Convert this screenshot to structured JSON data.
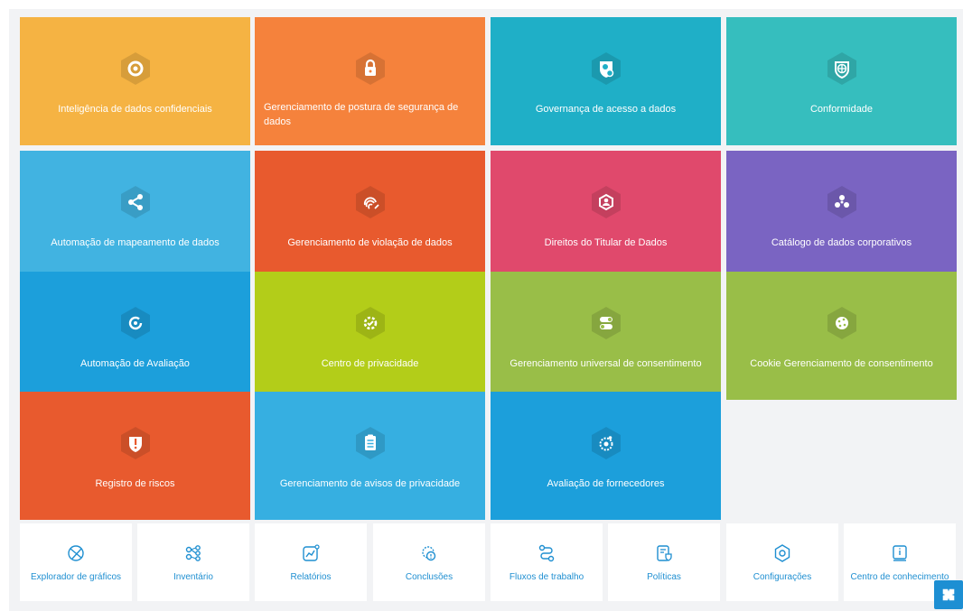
{
  "tiles": [
    {
      "label": "Inteligência de dados confidenciais",
      "color": "#f5b343",
      "icon": "shield-circle-icon"
    },
    {
      "label": "Gerenciamento de postura de segurança de dados",
      "color": "#f5823c",
      "icon": "lock-icon"
    },
    {
      "label": "Governança de acesso a dados",
      "color": "#1fafc7",
      "icon": "access-shield-icon"
    },
    {
      "label": "Conformidade",
      "color": "#36bebe",
      "icon": "globe-shield-icon"
    },
    {
      "label": "Automação de mapeamento de dados",
      "color": "#41b3e1",
      "icon": "share-icon"
    },
    {
      "label": "Gerenciamento de violação de dados",
      "color": "#e85a2e",
      "icon": "fingerprint-icon"
    },
    {
      "label": "Direitos do Titular de Dados",
      "color": "#e0496c",
      "icon": "person-shield-icon"
    },
    {
      "label": "Catálogo de dados corporativos",
      "color": "#7a64c2",
      "icon": "cluster-icon"
    },
    {
      "label": "Automação de Avaliação",
      "color": "#1c9fdb",
      "icon": "refresh-icon"
    },
    {
      "label": "Centro de privacidade",
      "color": "#b3cd19",
      "icon": "gear-shield-icon"
    },
    {
      "label": "Gerenciamento universal de consentimento",
      "color": "#99be48",
      "icon": "toggle-icon"
    },
    {
      "label": "Cookie Gerenciamento de consentimento",
      "color": "#99be48",
      "icon": "cookie-icon"
    },
    {
      "label": "Registro de riscos",
      "color": "#e85a2e",
      "icon": "warning-shield-icon"
    },
    {
      "label": "Gerenciamento de avisos de privacidade",
      "color": "#36afe1",
      "icon": "clipboard-icon"
    },
    {
      "label": "Avaliação de fornecedores",
      "color": "#1c9fdb",
      "icon": "vendor-icon"
    }
  ],
  "tools": [
    {
      "label": "Explorador de gráficos",
      "icon": "graph-explorer-icon"
    },
    {
      "label": "Inventário",
      "icon": "inventory-icon"
    },
    {
      "label": "Relatórios",
      "icon": "reports-icon"
    },
    {
      "label": "Conclusões",
      "icon": "findings-icon"
    },
    {
      "label": "Fluxos de trabalho",
      "icon": "workflow-icon"
    },
    {
      "label": "Políticas",
      "icon": "policies-icon"
    },
    {
      "label": "Configurações",
      "icon": "settings-icon"
    },
    {
      "label": "Centro de conhecimento",
      "icon": "knowledge-icon"
    }
  ],
  "accent": "#1f8fd1"
}
